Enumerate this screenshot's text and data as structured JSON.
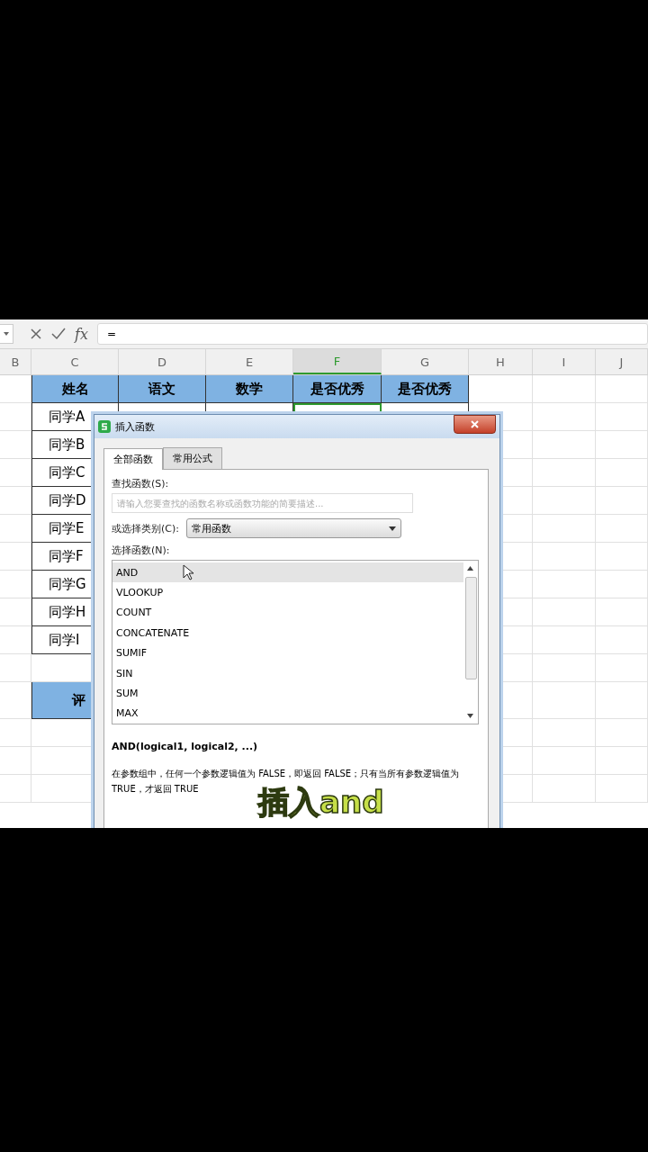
{
  "formula_bar": {
    "fx_label": "fx",
    "value": "="
  },
  "columns": [
    {
      "label": "B",
      "selected": false
    },
    {
      "label": "C",
      "selected": false
    },
    {
      "label": "D",
      "selected": false
    },
    {
      "label": "E",
      "selected": false
    },
    {
      "label": "F",
      "selected": true
    },
    {
      "label": "G",
      "selected": false
    },
    {
      "label": "H",
      "selected": false
    },
    {
      "label": "I",
      "selected": false
    },
    {
      "label": "J",
      "selected": false
    }
  ],
  "table": {
    "header": [
      "姓名",
      "语文",
      "数学",
      "是否优秀",
      "是否优秀"
    ],
    "names": [
      "同学A",
      "同学B",
      "同学C",
      "同学D",
      "同学E",
      "同学F",
      "同学G",
      "同学H",
      "同学I"
    ],
    "summary": "评"
  },
  "dialog": {
    "title": "插入函数",
    "tabs": [
      {
        "label": "全部函数",
        "selected": true
      },
      {
        "label": "常用公式",
        "selected": false
      }
    ],
    "search_label": "查找函数(S):",
    "search": {
      "placeholder": "请输入您要查找的函数名称或函数功能的简要描述..."
    },
    "category_label": "或选择类别(C):",
    "category": {
      "value": "常用函数"
    },
    "list_label": "选择函数(N):",
    "functions": [
      {
        "name": "AND",
        "selected": true
      },
      {
        "name": "VLOOKUP",
        "selected": false
      },
      {
        "name": "COUNT",
        "selected": false
      },
      {
        "name": "CONCATENATE",
        "selected": false
      },
      {
        "name": "SUMIF",
        "selected": false
      },
      {
        "name": "SIN",
        "selected": false
      },
      {
        "name": "SUM",
        "selected": false
      },
      {
        "name": "MAX",
        "selected": false
      }
    ],
    "signature": "AND(logical1, logical2, ...)",
    "description": "在参数组中，任何一个参数逻辑值为 FALSE，即返回 FALSE；只有当所有参数逻辑值为 TRUE，才返回 TRUE"
  },
  "caption": "插入and"
}
